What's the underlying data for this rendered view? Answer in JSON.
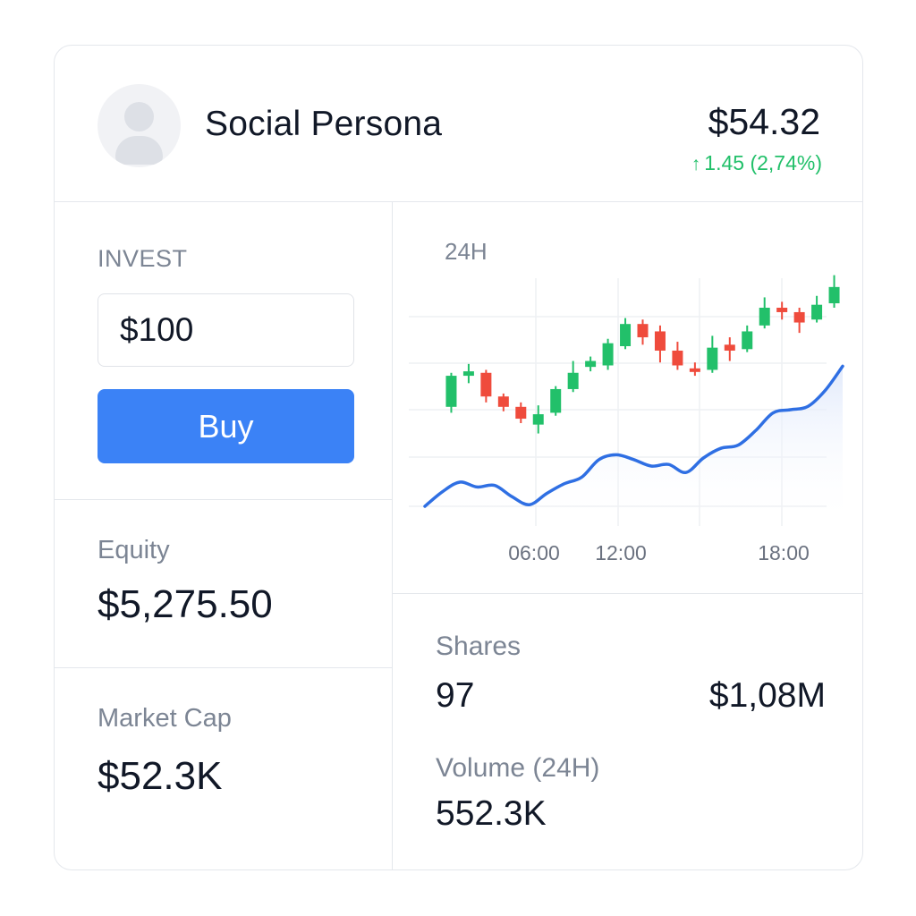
{
  "header": {
    "name": "Social Persona",
    "price": "$54.32",
    "change_arrow": "↑",
    "change": "1.45 (2,74%)",
    "avatar_icon": "user-avatar-icon"
  },
  "invest": {
    "label": "INVEST",
    "amount": "$100",
    "buy_label": "Buy"
  },
  "equity": {
    "label": "Equity",
    "value": "$5,275.50"
  },
  "market_cap": {
    "label": "Market Cap",
    "value": "$52.3K"
  },
  "shares": {
    "label": "Shares",
    "count": "97",
    "value": "$1,08M"
  },
  "volume": {
    "label": "Volume (24H)",
    "value": "552.3K"
  },
  "colors": {
    "up": "#22c06a",
    "down": "#ef4b3c",
    "accent": "#3b82f6",
    "line": "#2f6fe3"
  },
  "chart_data": {
    "type": "candlestick",
    "range_label": "24H",
    "x_tick_labels": [
      "06:00",
      "12:00",
      "18:00"
    ],
    "x_ticks_at": [
      6,
      12,
      18
    ],
    "xlim": [
      0,
      24
    ],
    "ylim": [
      0,
      100
    ],
    "grid": true,
    "candles": [
      {
        "t": 1.0,
        "o": 37,
        "c": 58,
        "h": 60,
        "l": 33
      },
      {
        "t": 2.0,
        "o": 58,
        "c": 61,
        "h": 66,
        "l": 53
      },
      {
        "t": 3.0,
        "o": 60,
        "c": 44,
        "h": 62,
        "l": 40
      },
      {
        "t": 4.0,
        "o": 44,
        "c": 37,
        "h": 46,
        "l": 34
      },
      {
        "t": 5.0,
        "o": 37,
        "c": 29,
        "h": 40,
        "l": 26
      },
      {
        "t": 6.0,
        "o": 25,
        "c": 32,
        "h": 38,
        "l": 19
      },
      {
        "t": 7.0,
        "o": 33,
        "c": 49,
        "h": 51,
        "l": 31
      },
      {
        "t": 8.0,
        "o": 49,
        "c": 60,
        "h": 68,
        "l": 47
      },
      {
        "t": 9.0,
        "o": 64,
        "c": 68,
        "h": 71,
        "l": 61
      },
      {
        "t": 10.0,
        "o": 65,
        "c": 80,
        "h": 83,
        "l": 62
      },
      {
        "t": 11.0,
        "o": 78,
        "c": 93,
        "h": 97,
        "l": 76
      },
      {
        "t": 12.0,
        "o": 93,
        "c": 84,
        "h": 96,
        "l": 79
      },
      {
        "t": 13.0,
        "o": 88,
        "c": 75,
        "h": 92,
        "l": 67
      },
      {
        "t": 14.0,
        "o": 75,
        "c": 65,
        "h": 81,
        "l": 62
      },
      {
        "t": 15.0,
        "o": 63,
        "c": 61,
        "h": 67,
        "l": 58
      },
      {
        "t": 16.0,
        "o": 62,
        "c": 77,
        "h": 85,
        "l": 60
      },
      {
        "t": 17.0,
        "o": 79,
        "c": 75,
        "h": 84,
        "l": 68
      },
      {
        "t": 18.0,
        "o": 76,
        "c": 88,
        "h": 92,
        "l": 74
      },
      {
        "t": 19.0,
        "o": 92,
        "c": 104,
        "h": 111,
        "l": 90
      },
      {
        "t": 20.0,
        "o": 104,
        "c": 101,
        "h": 108,
        "l": 96
      },
      {
        "t": 21.0,
        "o": 101,
        "c": 94,
        "h": 104,
        "l": 87
      },
      {
        "t": 22.0,
        "o": 96,
        "c": 106,
        "h": 112,
        "l": 94
      },
      {
        "t": 23.0,
        "o": 107,
        "c": 118,
        "h": 126,
        "l": 104
      }
    ],
    "line": [
      {
        "t": 0.0,
        "v": 0
      },
      {
        "t": 1.0,
        "v": 9
      },
      {
        "t": 2.0,
        "v": 15
      },
      {
        "t": 3.0,
        "v": 12
      },
      {
        "t": 4.0,
        "v": 13
      },
      {
        "t": 5.0,
        "v": 6
      },
      {
        "t": 6.0,
        "v": 1
      },
      {
        "t": 7.0,
        "v": 8
      },
      {
        "t": 8.0,
        "v": 14
      },
      {
        "t": 9.0,
        "v": 18
      },
      {
        "t": 10.0,
        "v": 29
      },
      {
        "t": 11.0,
        "v": 32
      },
      {
        "t": 12.0,
        "v": 29
      },
      {
        "t": 13.0,
        "v": 25
      },
      {
        "t": 14.0,
        "v": 26
      },
      {
        "t": 15.0,
        "v": 21
      },
      {
        "t": 16.0,
        "v": 30
      },
      {
        "t": 17.0,
        "v": 36
      },
      {
        "t": 18.0,
        "v": 38
      },
      {
        "t": 19.0,
        "v": 47
      },
      {
        "t": 20.0,
        "v": 58
      },
      {
        "t": 21.0,
        "v": 60
      },
      {
        "t": 22.0,
        "v": 62
      },
      {
        "t": 23.0,
        "v": 72
      },
      {
        "t": 24.0,
        "v": 87
      }
    ]
  }
}
